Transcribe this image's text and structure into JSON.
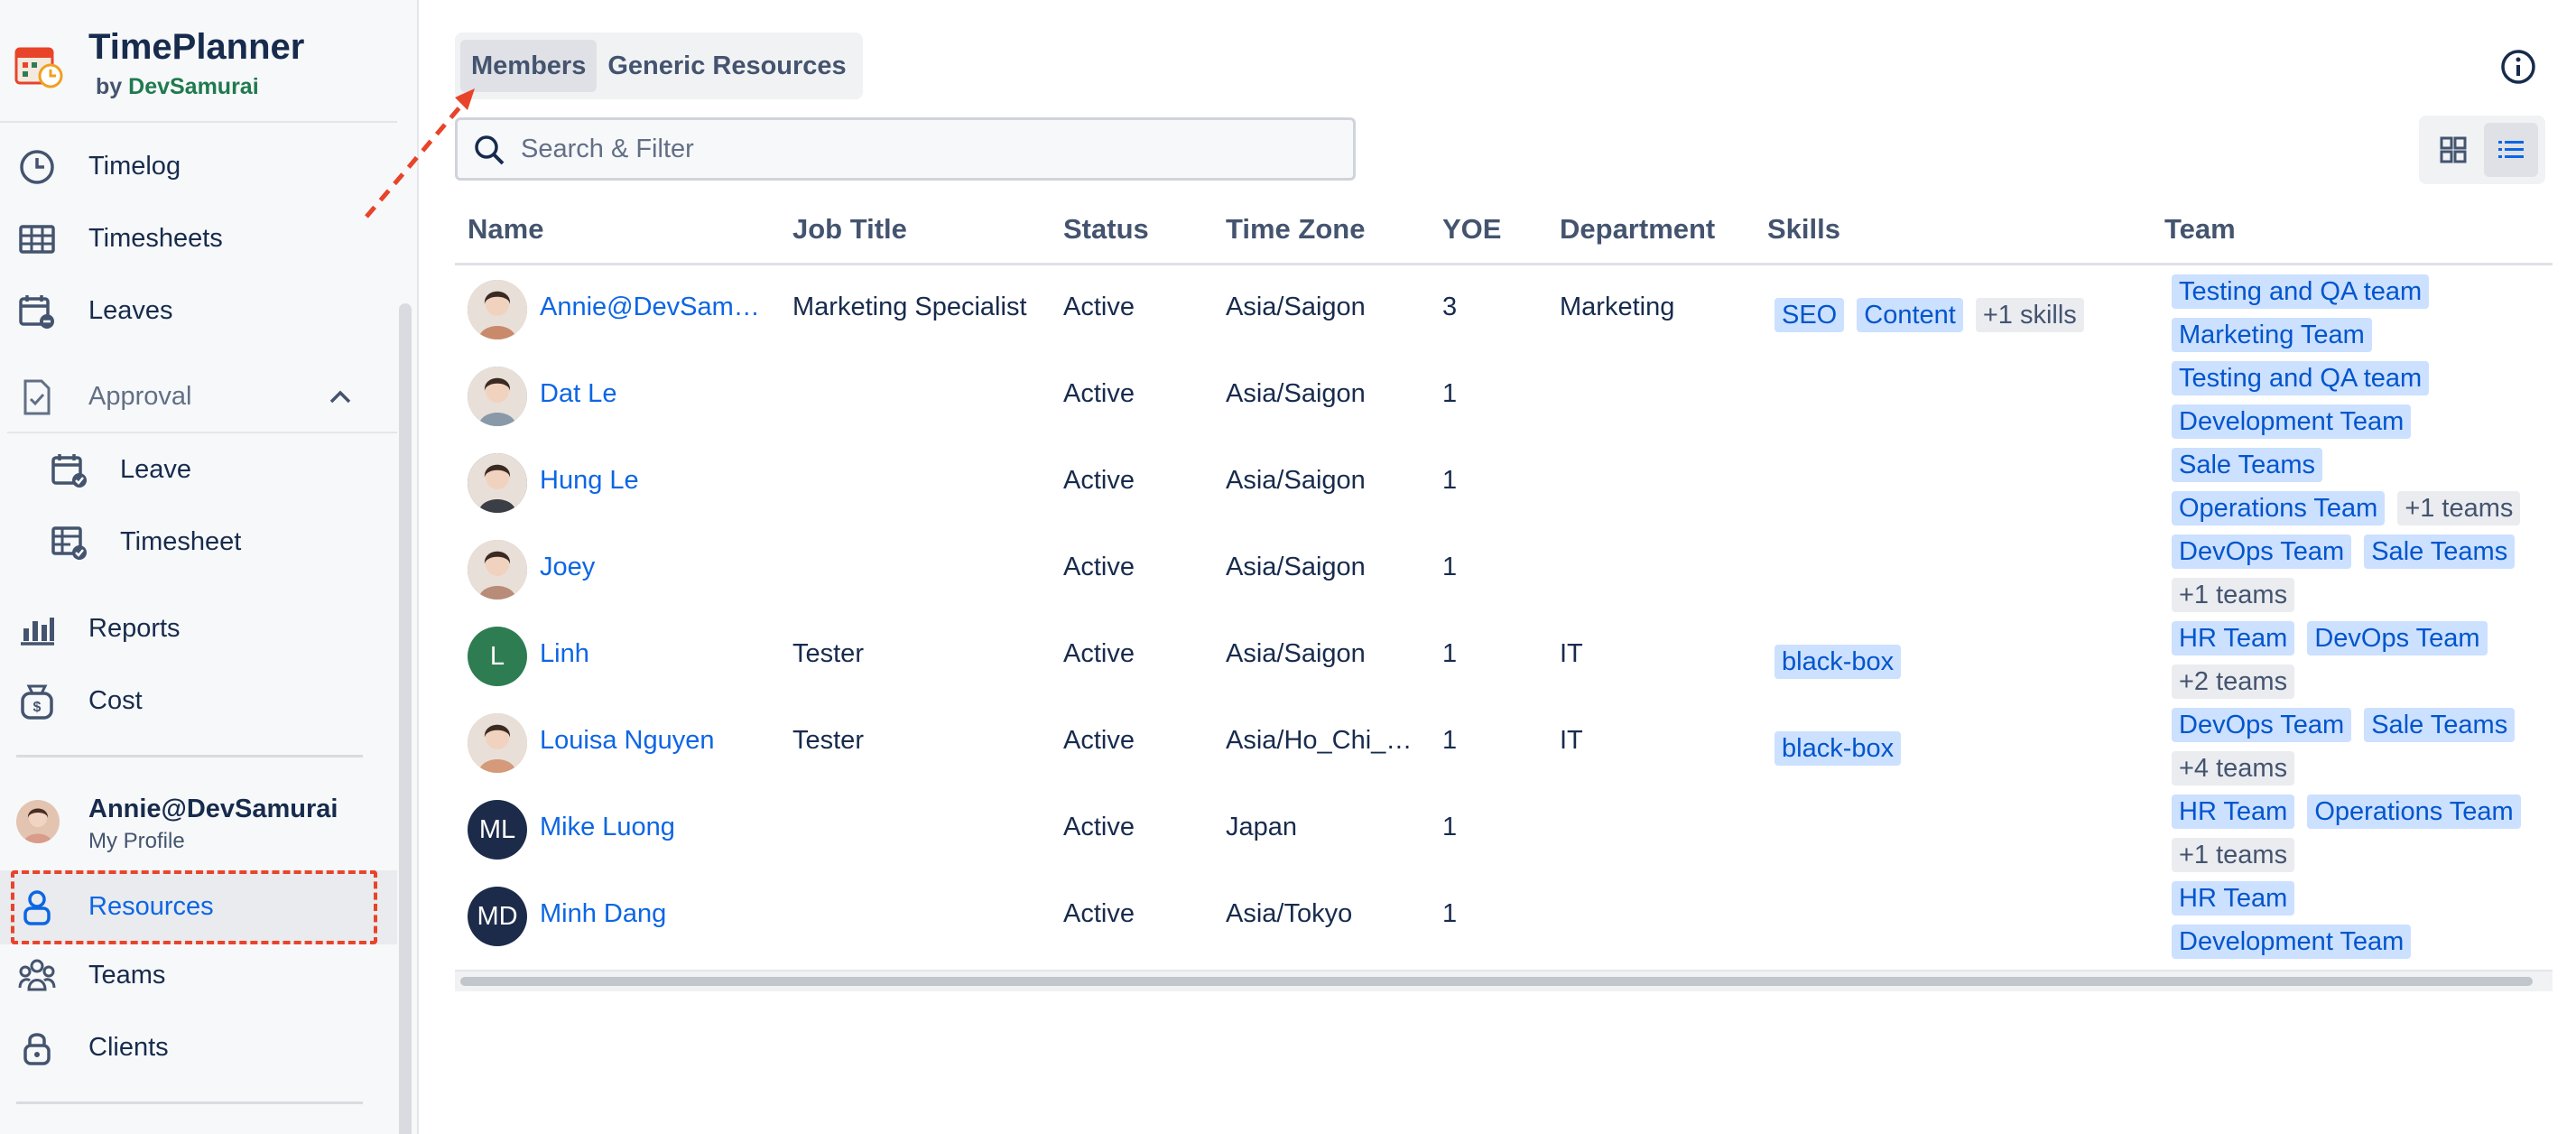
{
  "brand": {
    "title": "TimePlanner",
    "by": "by",
    "company": "DevSamurai"
  },
  "nav": [
    {
      "label": "Timelog",
      "icon": "clock-icon"
    },
    {
      "label": "Timesheets",
      "icon": "table-grid-icon"
    },
    {
      "label": "Leaves",
      "icon": "calendar-minus-icon"
    },
    {
      "label": "Approval",
      "icon": "clipboard-check-icon"
    },
    {
      "label": "Leave",
      "icon": "calendar-check-icon"
    },
    {
      "label": "Timesheet",
      "icon": "timesheet-check-icon"
    },
    {
      "label": "Reports",
      "icon": "bar-chart-icon"
    },
    {
      "label": "Cost",
      "icon": "money-bag-icon"
    },
    {
      "label": "Resources",
      "icon": "person-lock-icon"
    },
    {
      "label": "Teams",
      "icon": "people-group-icon"
    },
    {
      "label": "Clients",
      "icon": "client-lock-icon"
    }
  ],
  "profile": {
    "name": "Annie@DevSamurai",
    "sub": "My Profile"
  },
  "tabs": [
    {
      "label": "Members"
    },
    {
      "label": "Generic Resources"
    }
  ],
  "search": {
    "placeholder": "Search & Filter"
  },
  "table": {
    "headers": [
      "Name",
      "Job Title",
      "Status",
      "Time Zone",
      "YOE",
      "Department",
      "Skills",
      "Team"
    ],
    "rows": [
      {
        "name": "Annie@DevSam…",
        "initials": "",
        "avatar_color": "#c98a6b",
        "job": "Marketing Specialist",
        "status": "Active",
        "tz": "Asia/Saigon",
        "yoe": "3",
        "dept": "Marketing",
        "skills": [
          "SEO",
          "Content"
        ],
        "skills_more": "+1 skills",
        "teams1": [
          "Testing and QA team"
        ],
        "teams2": [
          "Marketing Team"
        ],
        "teams_more": ""
      },
      {
        "name": "Dat Le",
        "initials": "",
        "avatar_color": "#8a99a8",
        "job": "",
        "status": "Active",
        "tz": "Asia/Saigon",
        "yoe": "1",
        "dept": "",
        "skills": [],
        "skills_more": "",
        "teams1": [
          "Testing and QA team"
        ],
        "teams2": [
          "Development Team"
        ],
        "teams_more": ""
      },
      {
        "name": "Hung Le",
        "initials": "",
        "avatar_color": "#3b3f45",
        "job": "",
        "status": "Active",
        "tz": "Asia/Saigon",
        "yoe": "1",
        "dept": "",
        "skills": [],
        "skills_more": "",
        "teams1": [
          "Sale Teams"
        ],
        "teams2": [
          "Operations Team"
        ],
        "teams_more": "+1 teams"
      },
      {
        "name": "Joey",
        "initials": "",
        "avatar_color": "#b88c78",
        "job": "",
        "status": "Active",
        "tz": "Asia/Saigon",
        "yoe": "1",
        "dept": "",
        "skills": [],
        "skills_more": "",
        "teams1": [
          "DevOps Team",
          "Sale Teams"
        ],
        "teams2": [],
        "teams_more": "+1 teams"
      },
      {
        "name": "Linh",
        "initials": "L",
        "avatar_color": "#2e7d52",
        "job": "Tester",
        "status": "Active",
        "tz": "Asia/Saigon",
        "yoe": "1",
        "dept": "IT",
        "skills": [
          "black-box"
        ],
        "skills_more": "",
        "teams1": [
          "HR Team",
          "DevOps Team"
        ],
        "teams2": [],
        "teams_more": "+2 teams"
      },
      {
        "name": "Louisa Nguyen",
        "initials": "",
        "avatar_color": "#d49a7a",
        "job": "Tester",
        "status": "Active",
        "tz": "Asia/Ho_Chi_…",
        "yoe": "1",
        "dept": "IT",
        "skills": [
          "black-box"
        ],
        "skills_more": "",
        "teams1": [
          "DevOps Team",
          "Sale Teams"
        ],
        "teams2": [],
        "teams_more": "+4 teams"
      },
      {
        "name": "Mike Luong",
        "initials": "ML",
        "avatar_color": "#1c2b4a",
        "job": "",
        "status": "Active",
        "tz": "Japan",
        "yoe": "1",
        "dept": "",
        "skills": [],
        "skills_more": "",
        "teams1": [
          "HR Team",
          "Operations Team"
        ],
        "teams2": [],
        "teams_more": "+1 teams"
      },
      {
        "name": "Minh Dang",
        "initials": "MD",
        "avatar_color": "#1c2b4a",
        "job": "",
        "status": "Active",
        "tz": "Asia/Tokyo",
        "yoe": "1",
        "dept": "",
        "skills": [],
        "skills_more": "",
        "teams1": [
          "HR Team"
        ],
        "teams2": [
          "Development Team"
        ],
        "teams_more": ""
      }
    ]
  },
  "colors": {
    "accent": "#0c66e4",
    "chip_blue": "#cce0ff",
    "annotation_red": "#e8442a"
  }
}
